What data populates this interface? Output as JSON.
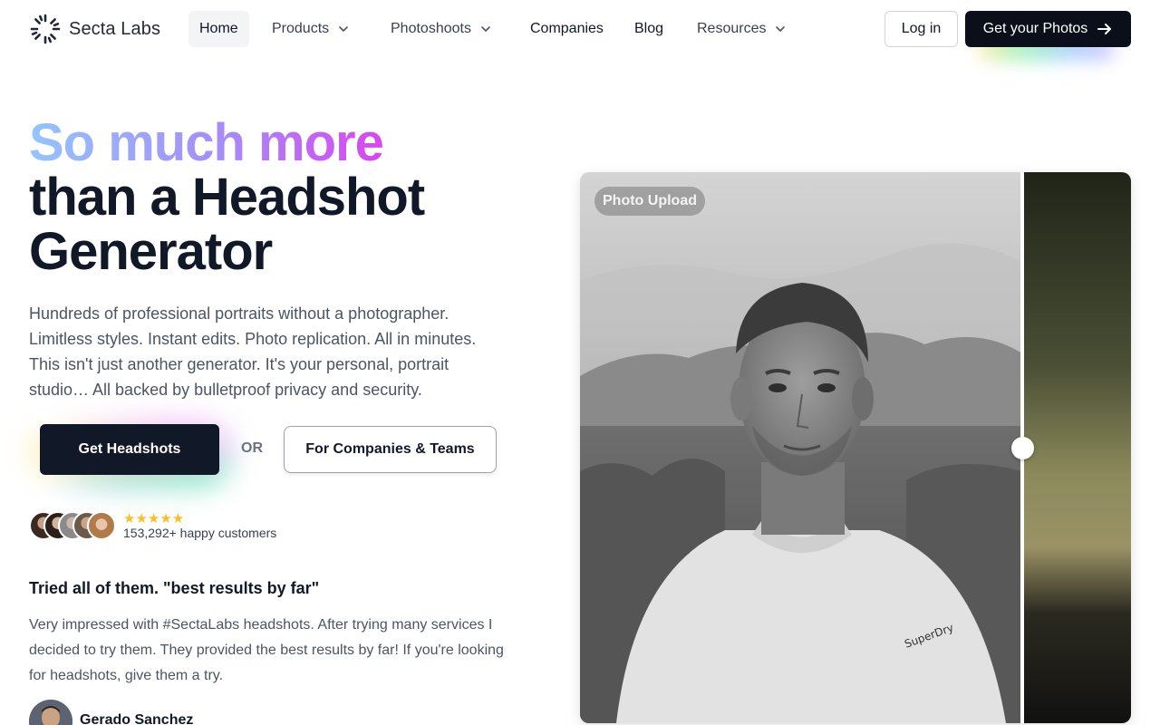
{
  "nav": {
    "brand": "Secta Labs",
    "items": [
      {
        "label": "Home"
      },
      {
        "label": "Products"
      },
      {
        "label": "Photoshoots"
      },
      {
        "label": "Companies"
      },
      {
        "label": "Blog"
      },
      {
        "label": "Resources"
      }
    ],
    "login": "Log in",
    "cta": "Get your Photos"
  },
  "hero": {
    "title_line1": "So much more",
    "title_line2": "than a Headshot",
    "title_line3": "Generator",
    "subtitle": "Hundreds of professional portraits without a photographer. Limitless styles. Instant edits. Photo replication. All in minutes. This isn't just another generator. It's your personal, portrait studio… All backed by bulletproof privacy and security.",
    "primary_button": "Get Headshots",
    "or": "OR",
    "secondary_button": "For Companies & Teams",
    "rating_stars": "★★★★★",
    "customers": "153,292+ happy customers"
  },
  "testimonial": {
    "title": "Tried all of them. \"best results by far\"",
    "body": "Very impressed with #SectaLabs headshots. After trying many services I decided to try them. They provided the best results by far! If you're looking for headshots, give them a try.",
    "author": "Gerado Sanchez"
  },
  "comparison": {
    "badge": "Photo Upload",
    "slider_position": 0.8
  },
  "colors": {
    "primary": "#111827",
    "gradient_start": "#93c5fd",
    "gradient_end": "#d946ef",
    "star": "#fbbf24"
  }
}
